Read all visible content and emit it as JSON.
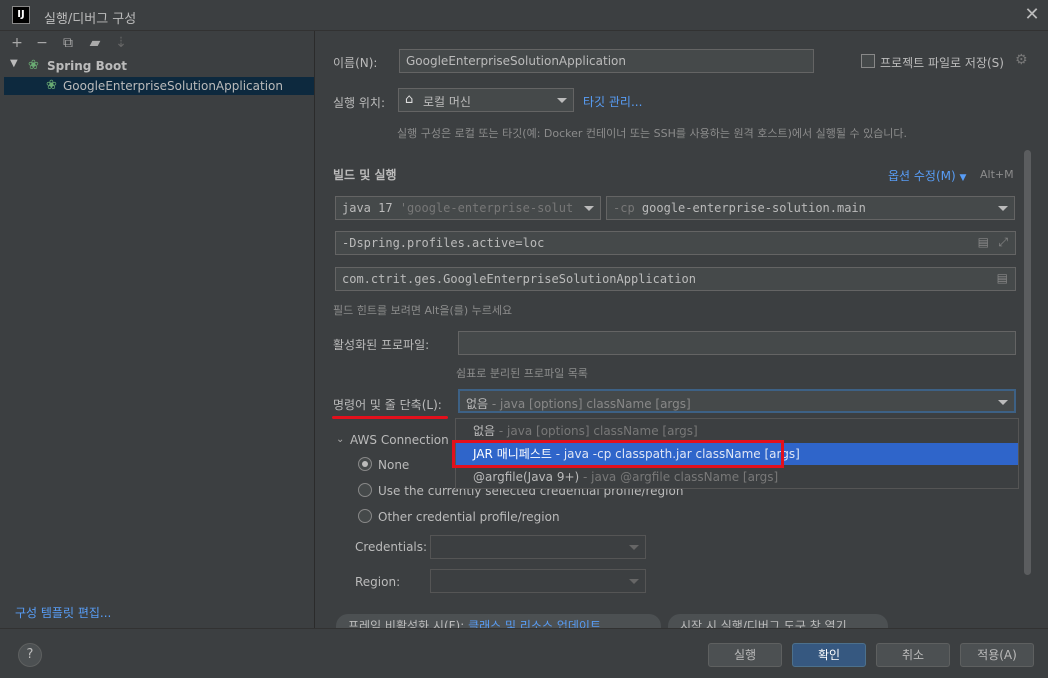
{
  "window": {
    "title": "실행/디버그 구성",
    "icon_text": "IJ"
  },
  "toolbar": {
    "icons": [
      "add-icon",
      "remove-icon",
      "copy-icon",
      "folder-icon",
      "sort-icon"
    ]
  },
  "tree": {
    "group": "Spring Boot",
    "item": "GoogleEnterpriseSolutionApplication"
  },
  "left_footer": {
    "edit_templates": "구성 템플릿 편집..."
  },
  "form": {
    "name_label": "이름(N):",
    "name_value": "GoogleEnterpriseSolutionApplication",
    "store_as_file": "프로젝트 파일로 저장(S)",
    "run_on_label": "실행 위치:",
    "run_on_value": "로컬 머신",
    "manage_targets": "타깃 관리...",
    "run_on_hint": "실행 구성은 로컬 또는 타깃(예: Docker 컨테이너 또는 SSH를 사용하는 원격 호스트)에서 실행될 수 있습니다.",
    "build_run_header": "빌드 및 실행",
    "modify_options": "옵션 수정(M)",
    "modify_shortcut": "Alt+M",
    "jdk_value": "java 17",
    "jdk_module": "'google-enterprise-solutio",
    "cp_prefix": "-cp",
    "cp_value": "google-enterprise-solution.main",
    "vm_options": "-Dspring.profiles.active=loc",
    "main_class": "com.ctrit.ges.GoogleEnterpriseSolutionApplication",
    "field_hint": "필드 힌트를 보려면 Alt을(를) 누르세요",
    "active_profiles_label": "활성화된 프로파일:",
    "active_profiles_hint": "쉼표로 분리된 프로파일 목록",
    "shorten_label": "명령어 및 줄 단축(L):",
    "shorten_value_main": "없음",
    "shorten_value_dim": " - java [options] className [args]"
  },
  "popup": {
    "items": [
      {
        "main": "없음",
        "dim": " - java [options] className [args]"
      },
      {
        "main": "JAR 매니페스트",
        "dim": " - java -cp classpath.jar className [args]"
      },
      {
        "main": "@argfile(Java 9+)",
        "dim": " - java @argfile className [args]"
      }
    ]
  },
  "aws": {
    "header": "AWS Connection",
    "options": [
      "None",
      "Use the currently selected credential profile/region",
      "Other credential profile/region"
    ],
    "credentials_label": "Credentials:",
    "region_label": "Region:"
  },
  "chips": {
    "frame_label": "프레임 비활성화 시(F):",
    "frame_value": "클래스 및 리소스 업데이트",
    "startup": "시작 시 실행/디버그 도구 창 열기"
  },
  "buttons": {
    "help": "?",
    "run": "실행",
    "ok": "확인",
    "cancel": "취소",
    "apply": "적용(A)"
  }
}
